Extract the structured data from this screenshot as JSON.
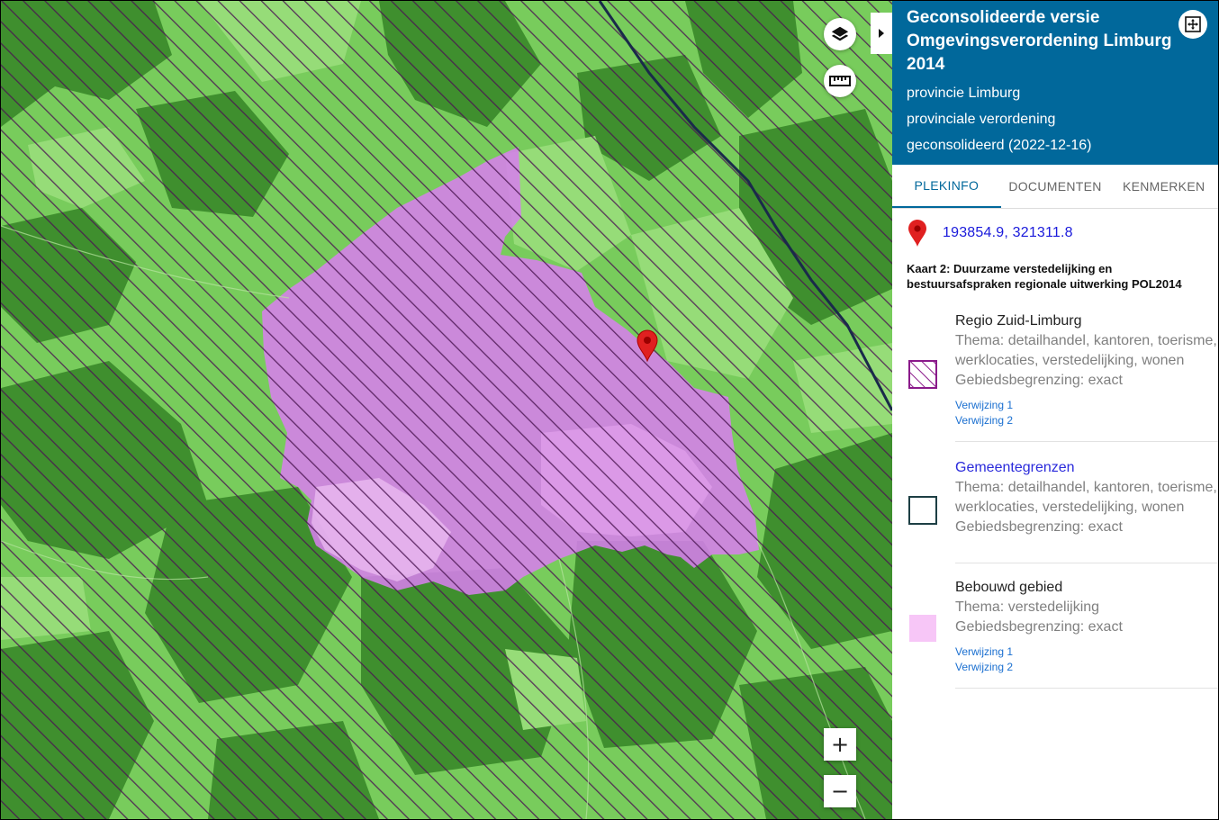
{
  "header": {
    "title": "Geconsolideerde versie Omgevingsverordening Limburg 2014",
    "authority": "provincie Limburg",
    "doc_type": "provinciale verordening",
    "status": "geconsolideerd (2022-12-16)"
  },
  "tabs": [
    {
      "label": "PLEKINFO",
      "active": true
    },
    {
      "label": "DOCUMENTEN",
      "active": false
    },
    {
      "label": "KENMERKEN",
      "active": false
    }
  ],
  "location": {
    "coordinates": "193854.9, 321311.8",
    "icon": "map-marker-icon"
  },
  "map_section_title": "Kaart 2: Duurzame verstedelijking en bestuursafspraken regionale uitwerking POL2014",
  "legend": [
    {
      "name": "Regio Zuid-Limburg",
      "thema": "Thema: detailhandel, kantoren, toerisme, werklocaties, verstedelijking, wonen",
      "begrenzing": "Gebiedsbegrenzing: exact",
      "links": [
        "Verwijzing 1",
        "Verwijzing 2"
      ],
      "symbol": "purple-hatch",
      "color": "#8a1a8a"
    },
    {
      "name": "Gemeentegrenzen",
      "thema": "Thema: detailhandel, kantoren, toerisme, werklocaties, verstedelijking, wonen",
      "begrenzing": "Gebiedsbegrenzing: exact",
      "links": [],
      "symbol": "outline-square",
      "color": "#1d3f44"
    },
    {
      "name": "Bebouwd gebied",
      "thema": "Thema: verstedelijking",
      "begrenzing": "Gebiedsbegrenzing: exact",
      "links": [
        "Verwijzing 1",
        "Verwijzing 2"
      ],
      "symbol": "pink-fill",
      "color": "#f7c6f7"
    }
  ],
  "map_controls": {
    "layers": "layers-icon",
    "measure": "ruler-icon",
    "zoom_in": "+",
    "zoom_out": "−"
  },
  "colors": {
    "header_bg": "#01689b",
    "green_light": "#86d46a",
    "green_dark": "#4a9a35",
    "hatch": "#5a1a5a",
    "built_area": "#d070e0"
  }
}
